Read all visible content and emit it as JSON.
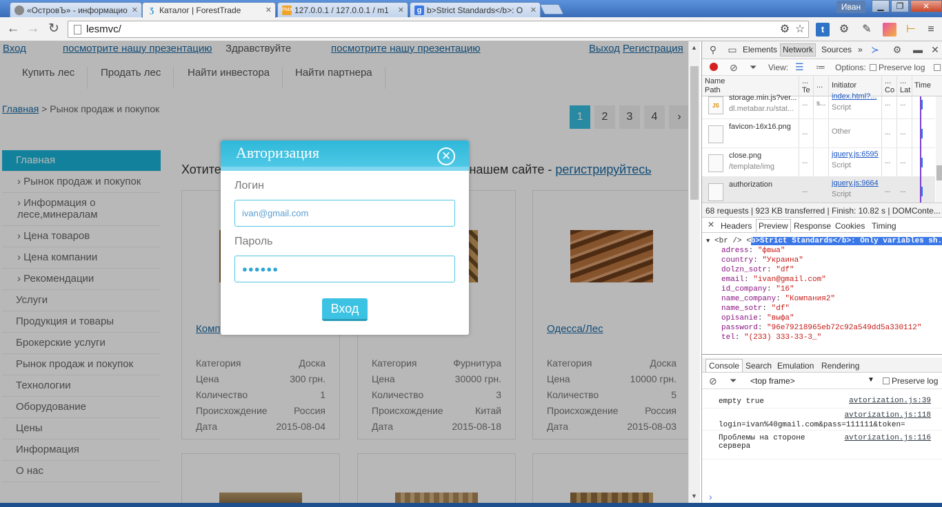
{
  "browser": {
    "tabs": [
      {
        "title": "«ОстровЪ» - информацио",
        "icon": "dot-icon"
      },
      {
        "title": "Каталог | ForestTrade",
        "icon": "ft-logo-icon"
      },
      {
        "title": "127.0.0.1 / 127.0.0.1 / m1",
        "icon": "phpmyadmin-icon"
      },
      {
        "title": "b>Strict Standards</b>: O",
        "icon": "google-icon"
      }
    ],
    "user": "Иван",
    "address": "lesmvc/"
  },
  "site": {
    "top": {
      "login": "Вход",
      "presentation1": "посмотрите нашу презентацию",
      "hello": "Здравствуйте",
      "presentation2": "посмотрите нашу презентацию",
      "logout": "Выход",
      "register": "Регистрация"
    },
    "menu": [
      "Купить лес",
      "Продать лес",
      "Найти инвестора",
      "Найти партнера"
    ],
    "breadcrumb": {
      "home": "Главная",
      "sep": " > ",
      "current": "Рынок продаж и покупок"
    },
    "pages": [
      "1",
      "2",
      "3",
      "4",
      "›"
    ],
    "sidebar": [
      {
        "label": "Главная",
        "type": "active"
      },
      {
        "label": "› Рынок продаж и покупок",
        "type": "sub"
      },
      {
        "label": "› Информация о лесе,минералам",
        "type": "sub two"
      },
      {
        "label": "› Цена товаров",
        "type": "sub"
      },
      {
        "label": "› Цена компании",
        "type": "sub"
      },
      {
        "label": "› Рекомендации",
        "type": "sub"
      },
      {
        "label": "Услуги",
        "type": ""
      },
      {
        "label": "Продукция и товары",
        "type": ""
      },
      {
        "label": "Брокерские услуги",
        "type": ""
      },
      {
        "label": "Рынок продаж и покупок",
        "type": ""
      },
      {
        "label": "Технологии",
        "type": ""
      },
      {
        "label": "Оборудование",
        "type": ""
      },
      {
        "label": "Цены",
        "type": ""
      },
      {
        "label": "Информация",
        "type": ""
      },
      {
        "label": "О нас",
        "type": ""
      }
    ],
    "headline": {
      "prefix": "Хотите",
      "suffix": "я на нашем сайте - ",
      "link": "регистрируйтесь"
    },
    "field_labels": {
      "category": "Категория",
      "price": "Цена",
      "qty": "Количество",
      "origin": "Происхождение",
      "date": "Дата"
    },
    "cards": [
      {
        "title": "Комп",
        "category": "Доска",
        "price": "300 грн.",
        "qty": "1",
        "origin": "Россия",
        "date": "2015-08-04"
      },
      {
        "title": "",
        "category": "Фурнитура",
        "price": "30000 грн.",
        "qty": "3",
        "origin": "Китай",
        "date": "2015-08-18"
      },
      {
        "title": "Одесса/Лес",
        "category": "Доска",
        "price": "10000 грн.",
        "qty": "5",
        "origin": "Россия",
        "date": "2015-08-03"
      }
    ]
  },
  "modal": {
    "title": "Авторизация",
    "login_label": "Логин",
    "login_value": "ivan@gmail.com",
    "password_label": "Пароль",
    "password_mask": "●●●●●●",
    "submit": "Вход"
  },
  "devtools": {
    "tabs": [
      "Elements",
      "Network",
      "Sources",
      "»"
    ],
    "view_label": "View:",
    "options_label": "Options:",
    "preserve_log": "Preserve log",
    "columns": {
      "name": "Name",
      "path": "Path",
      "te": "Te",
      "dots": "...",
      "initiator": "Initiator",
      "co": "Co",
      "lat": "Lat",
      "time": "Time"
    },
    "requests": [
      {
        "name": "storage.min.js?ver...",
        "path": "dl.metabar.ru/stat...",
        "initiator": "index.html?...",
        "type": "Script",
        "s": "s...",
        "icon": "JS"
      },
      {
        "name": "favicon-16x16.png",
        "path": "",
        "initiator": "",
        "type": "Other",
        "s": "",
        "icon": ""
      },
      {
        "name": "close.png",
        "path": "/template/img",
        "initiator": "jquery.js:6595",
        "type": "Script",
        "s": "",
        "icon": ""
      },
      {
        "name": "authorization",
        "path": "",
        "initiator": "jquery.js:9664",
        "type": "Script",
        "s": "",
        "icon": ""
      }
    ],
    "status": "68 requests  |  923 KB transferred  |  Finish: 10.82 s  |  DOMConte...",
    "preview_tabs": [
      "Headers",
      "Preview",
      "Response",
      "Cookies",
      "Timing"
    ],
    "preview_head": "<br /> <",
    "preview_head_sel": "b>Strict Standards</b>: Only variables sh...",
    "preview_lines": [
      {
        "k": "adress",
        "v": "\"фвыа\""
      },
      {
        "k": "country",
        "v": "\"Украина\""
      },
      {
        "k": "dolzn_sotr",
        "v": "\"df\""
      },
      {
        "k": "email",
        "v": "\"ivan@gmail.com\""
      },
      {
        "k": "id_company",
        "v": "\"16\""
      },
      {
        "k": "name_company",
        "v": "\"Компания2\""
      },
      {
        "k": "name_sotr",
        "v": "\"df\""
      },
      {
        "k": "opisanie",
        "v": "\"выфа\""
      },
      {
        "k": "password",
        "v": "\"96e79218965eb72c92a549dd5a330112\""
      },
      {
        "k": "tel",
        "v": "\"(233) 333-33-3_\""
      }
    ],
    "drawer_tabs": [
      "Console",
      "Search",
      "Emulation",
      "Rendering"
    ],
    "frame": "<top frame>",
    "console": [
      {
        "msg": "empty true",
        "src": "avtorization.js:39"
      },
      {
        "msg": "login=ivan%40gmail.com&pass=111111&token=",
        "src": "avtorization.js:118"
      },
      {
        "msg": "Проблемы на стороне\nсервера",
        "src": "avtorization.js:116"
      }
    ],
    "prompt": "›"
  }
}
